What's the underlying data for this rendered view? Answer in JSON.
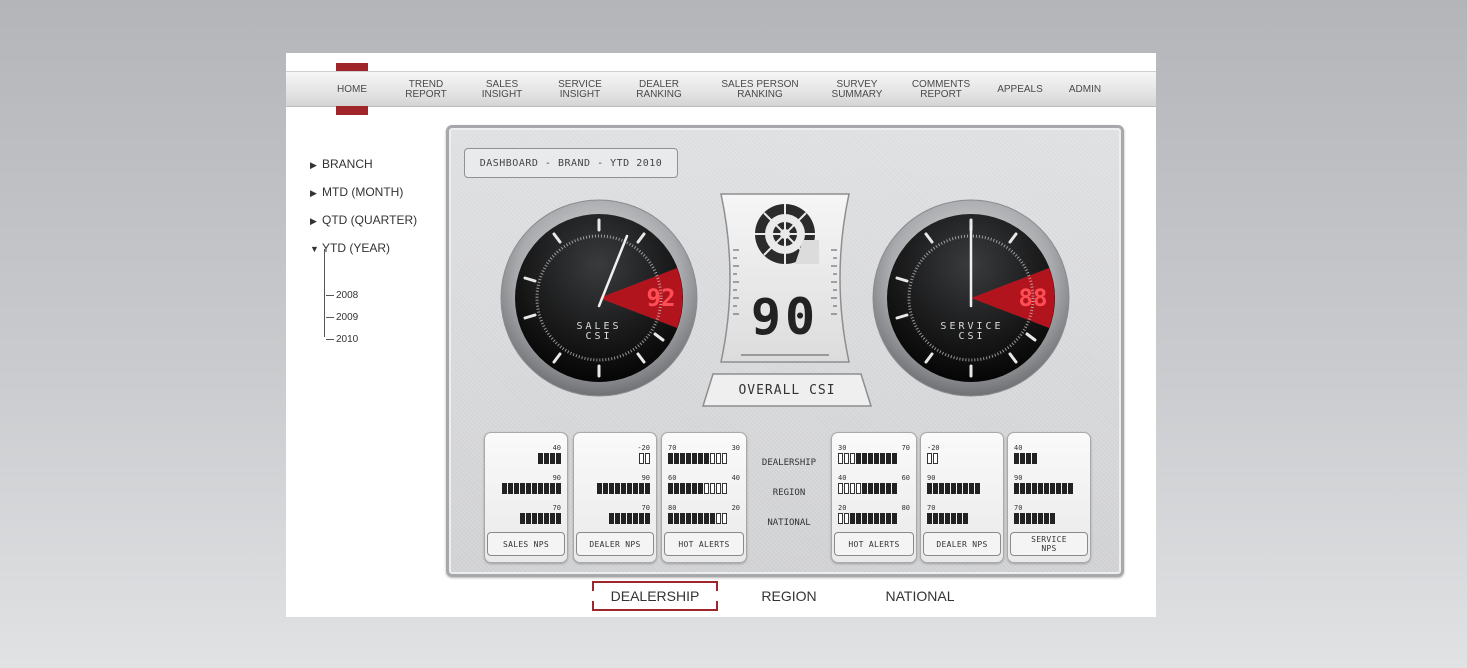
{
  "nav": {
    "items": [
      {
        "label": "HOME",
        "active": true
      },
      {
        "label": "TREND\nREPORT"
      },
      {
        "label": "SALES\nINSIGHT"
      },
      {
        "label": "SERVICE\nINSIGHT"
      },
      {
        "label": "DEALER\nRANKING"
      },
      {
        "label": "SALES PERSON\nRANKING"
      },
      {
        "label": "SURVEY\nSUMMARY"
      },
      {
        "label": "COMMENTS\nREPORT"
      },
      {
        "label": "APPEALS"
      },
      {
        "label": "ADMIN"
      }
    ],
    "accent_color": "#a1262b"
  },
  "sidebar": {
    "items": [
      {
        "label": "BRANCH",
        "icon": "triangle-right-icon"
      },
      {
        "label": "MTD (MONTH)",
        "icon": "triangle-right-icon"
      },
      {
        "label": "QTD (QUARTER)",
        "icon": "triangle-right-icon"
      },
      {
        "label": "YTD (YEAR)",
        "icon": "triangle-down-icon",
        "expanded": true
      }
    ],
    "years": [
      "2008",
      "2009",
      "2010"
    ]
  },
  "dashboard": {
    "title": "DASHBOARD - BRAND - YTD 2010",
    "sales_gauge": {
      "label_line1": "SALES",
      "label_line2": "CSI",
      "value": "92"
    },
    "service_gauge": {
      "label_line1": "SERVICE",
      "label_line2": "CSI",
      "value": "88"
    },
    "overall": {
      "value": "90",
      "label": "OVERALL CSI",
      "icon": "nautilus-logo-icon"
    },
    "row_labels": [
      "DEALERSHIP",
      "REGION",
      "NATIONAL"
    ],
    "cards": [
      {
        "label": "SALES NPS",
        "rows": [
          {
            "a": "40",
            "b": ""
          },
          {
            "a": "90",
            "b": ""
          },
          {
            "a": "70",
            "b": ""
          }
        ]
      },
      {
        "label": "DEALER NPS",
        "rows": [
          {
            "a": "-20",
            "b": ""
          },
          {
            "a": "90",
            "b": ""
          },
          {
            "a": "70",
            "b": ""
          }
        ]
      },
      {
        "label": "HOT ALERTS",
        "rows": [
          {
            "a": "70",
            "b": "30"
          },
          {
            "a": "60",
            "b": "40"
          },
          {
            "a": "80",
            "b": "20"
          }
        ]
      },
      {
        "label": "HOT ALERTS",
        "rows": [
          {
            "a": "30",
            "b": "70"
          },
          {
            "a": "40",
            "b": "60"
          },
          {
            "a": "20",
            "b": "80"
          }
        ]
      },
      {
        "label": "DEALER NPS",
        "rows": [
          {
            "a": "-20",
            "b": ""
          },
          {
            "a": "90",
            "b": ""
          },
          {
            "a": "70",
            "b": ""
          }
        ]
      },
      {
        "label": "SERVICE\nNPS",
        "rows": [
          {
            "a": "40",
            "b": ""
          },
          {
            "a": "90",
            "b": ""
          },
          {
            "a": "70",
            "b": ""
          }
        ]
      }
    ]
  },
  "bottom_tabs": [
    {
      "label": "DEALERSHIP",
      "active": true
    },
    {
      "label": "REGION"
    },
    {
      "label": "NATIONAL"
    }
  ]
}
